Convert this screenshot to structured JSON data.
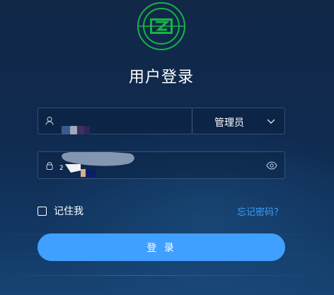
{
  "brand": {
    "logo_icon": "green-circle-z-logo",
    "accent_color": "#18b14a"
  },
  "login": {
    "title": "用户登录",
    "username_icon": "user-icon",
    "password_icon": "lock-icon",
    "password_visible_icon": "eye-icon",
    "username_value_obscured": true,
    "password_value_obscured": true,
    "password_first_visible_char": "2",
    "role_select": {
      "selected": "管理员",
      "icon": "chevron-down-icon"
    },
    "remember_label": "记住我",
    "remember_checked": false,
    "forgot_label": "忘记密码？",
    "submit_label": "登 录"
  },
  "colors": {
    "primary": "#40a0ff",
    "link": "#3ba0ff",
    "background": "#112847"
  }
}
